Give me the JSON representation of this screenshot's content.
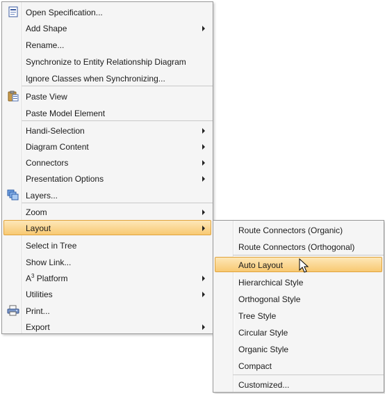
{
  "main_menu": {
    "items": [
      {
        "label": "Open Specification...",
        "icon": "specification-icon"
      },
      {
        "label": "Add Shape",
        "submenu": true
      },
      {
        "label": "Rename..."
      },
      {
        "label": "Synchronize to Entity Relationship Diagram"
      },
      {
        "label": "Ignore Classes when Synchronizing..."
      },
      {
        "label": "Paste View",
        "icon": "clipboard-icon"
      },
      {
        "label": "Paste Model Element"
      },
      {
        "label": "Handi-Selection",
        "submenu": true
      },
      {
        "label": "Diagram Content",
        "submenu": true
      },
      {
        "label": "Connectors",
        "submenu": true
      },
      {
        "label": "Presentation Options",
        "submenu": true
      },
      {
        "label": "Layers...",
        "icon": "layers-icon"
      },
      {
        "label": "Zoom",
        "submenu": true
      },
      {
        "label": "Layout",
        "submenu": true,
        "highlighted": true
      },
      {
        "label": "Select in Tree"
      },
      {
        "label": "Show Link..."
      },
      {
        "label": "A",
        "label_sup": "3",
        "label_rest": " Platform",
        "submenu": true
      },
      {
        "label": "Utilities",
        "submenu": true
      },
      {
        "label": "Print...",
        "icon": "printer-icon"
      },
      {
        "label": "Export",
        "submenu": true
      }
    ]
  },
  "layout_submenu": {
    "items": [
      {
        "label": "Route Connectors (Organic)"
      },
      {
        "label": "Route Connectors (Orthogonal)"
      },
      {
        "label": "Auto Layout",
        "highlighted": true
      },
      {
        "label": "Hierarchical Style"
      },
      {
        "label": "Orthogonal Style"
      },
      {
        "label": "Tree Style"
      },
      {
        "label": "Circular Style"
      },
      {
        "label": "Organic Style"
      },
      {
        "label": "Compact"
      },
      {
        "label": "Customized..."
      }
    ]
  },
  "colors": {
    "highlight_top": "#fde7b8",
    "highlight_bottom": "#f8c972",
    "highlight_border": "#e0a33c",
    "menu_background": "#f5f5f5",
    "menu_border": "#979797"
  }
}
